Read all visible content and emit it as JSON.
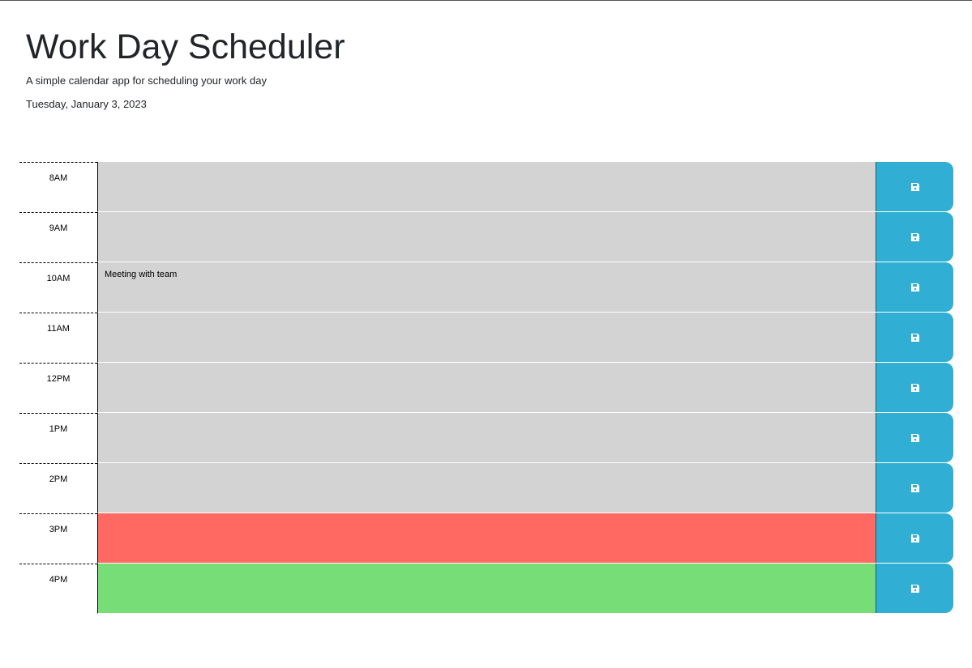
{
  "header": {
    "title": "Work Day Scheduler",
    "lead": "A simple calendar app for scheduling your work day",
    "current_date": "Tuesday, January 3, 2023"
  },
  "colors": {
    "past": "#d3d3d3",
    "present": "#ff6961",
    "future": "#77dd77",
    "save_button": "#31aed4"
  },
  "save_icon": "floppy-disk-icon",
  "rows": [
    {
      "hour": "8AM",
      "text": "",
      "status": "past"
    },
    {
      "hour": "9AM",
      "text": "",
      "status": "past"
    },
    {
      "hour": "10AM",
      "text": "Meeting with team",
      "status": "past"
    },
    {
      "hour": "11AM",
      "text": "",
      "status": "past"
    },
    {
      "hour": "12PM",
      "text": "",
      "status": "past"
    },
    {
      "hour": "1PM",
      "text": "",
      "status": "past"
    },
    {
      "hour": "2PM",
      "text": "",
      "status": "past"
    },
    {
      "hour": "3PM",
      "text": "",
      "status": "present"
    },
    {
      "hour": "4PM",
      "text": "",
      "status": "future"
    }
  ]
}
